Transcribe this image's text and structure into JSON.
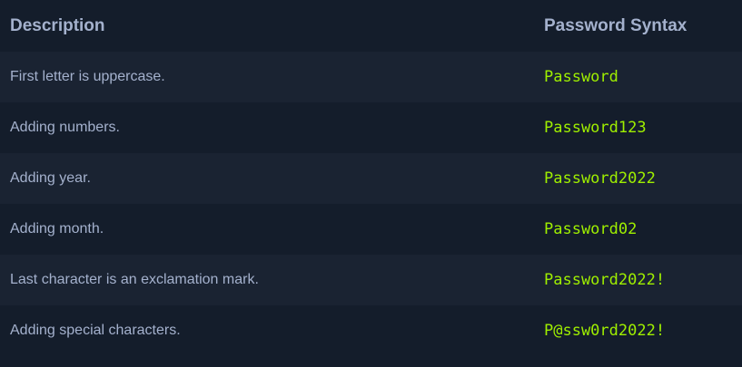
{
  "table": {
    "headers": {
      "description": "Description",
      "syntax": "Password Syntax"
    },
    "rows": [
      {
        "description": "First letter is uppercase.",
        "syntax": "Password"
      },
      {
        "description": "Adding numbers.",
        "syntax": "Password123"
      },
      {
        "description": "Adding year.",
        "syntax": "Password2022"
      },
      {
        "description": "Adding month.",
        "syntax": "Password02"
      },
      {
        "description": "Last character is an exclamation mark.",
        "syntax": "Password2022!"
      },
      {
        "description": "Adding special characters.",
        "syntax": "P@ssw0rd2022!"
      }
    ]
  },
  "colors": {
    "background": "#141d2b",
    "row_alt": "#1a2332",
    "text": "#a4b1cd",
    "accent_green": "#9fef00"
  }
}
